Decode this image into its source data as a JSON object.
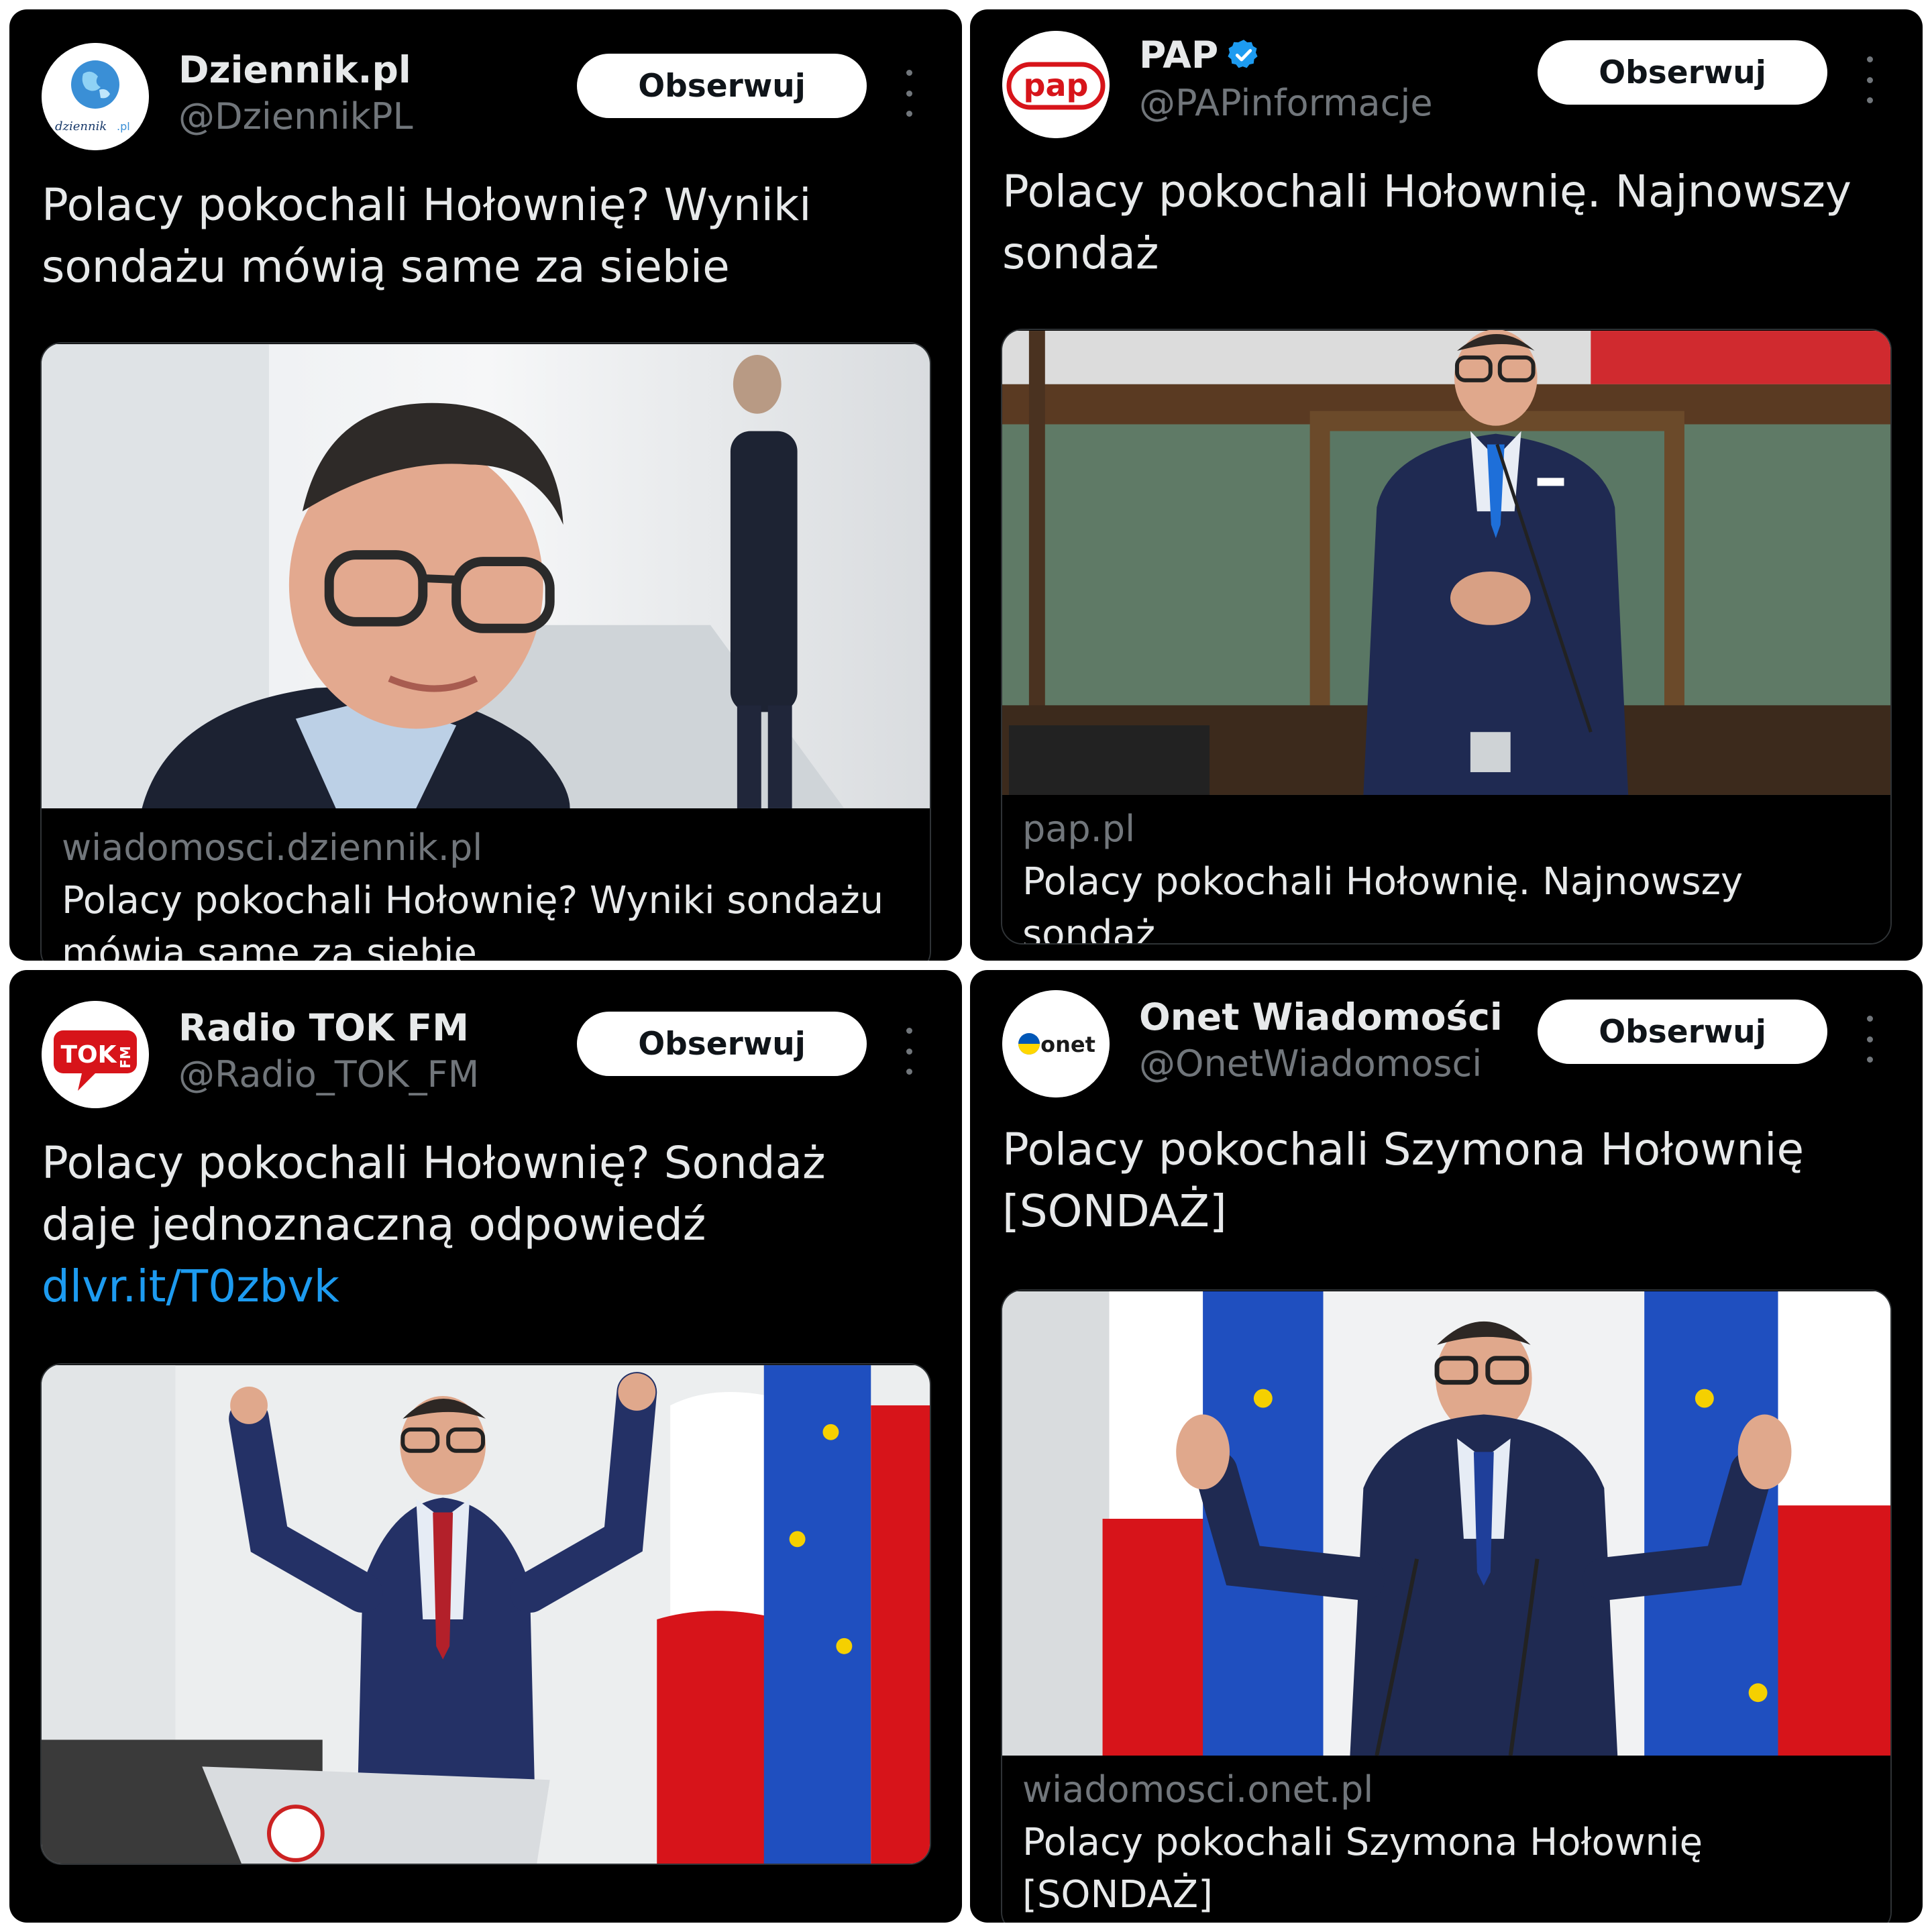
{
  "posts": [
    {
      "name": "Dziennik.pl",
      "handle": "@DziennikPL",
      "follow_label": "Obserwuj",
      "text": "Polacy pokochali Hołownię? Wyniki sondażu mówią same za siebie",
      "link_domain": "wiadomosci.dziennik.pl",
      "link_title": "Polacy pokochali Hołownię? Wyniki sondażu mówią same za siebie",
      "avatar_label": "dziennik.pl"
    },
    {
      "name": "PAP",
      "handle": "@PAPinformacje",
      "follow_label": "Obserwuj",
      "verified": true,
      "text": "Polacy pokochali Hołownię. Najnowszy sondaż",
      "link_domain": "pap.pl",
      "link_title": "Polacy pokochali Hołownię. Najnowszy sondaż",
      "avatar_label": "pap"
    },
    {
      "name": "Radio TOK FM",
      "handle": "@Radio_TOK_FM",
      "follow_label": "Obserwuj",
      "text": "Polacy pokochali Hołownię? Sondaż daje jednoznaczną odpowiedź ",
      "text_link": "dlvr.it/T0zbvk",
      "avatar_label": "TOK FM"
    },
    {
      "name": "Onet Wiadomości",
      "handle": "@OnetWiadomosci",
      "follow_label": "Obserwuj",
      "text": "Polacy pokochali Szymona Hołownię [SONDAŻ]",
      "link_domain": "wiadomosci.onet.pl",
      "link_title": "Polacy pokochali Szymona Hołownię [SONDAŻ]",
      "avatar_label": "onet"
    }
  ],
  "colors": {
    "background": "#ffffff",
    "card": "#000000",
    "text": "#e7e9ea",
    "secondary": "#71767b",
    "link": "#1d9bf0",
    "verified": "#1d9bf0"
  },
  "icons": [
    "more-vert-icon",
    "verified-badge-icon"
  ]
}
